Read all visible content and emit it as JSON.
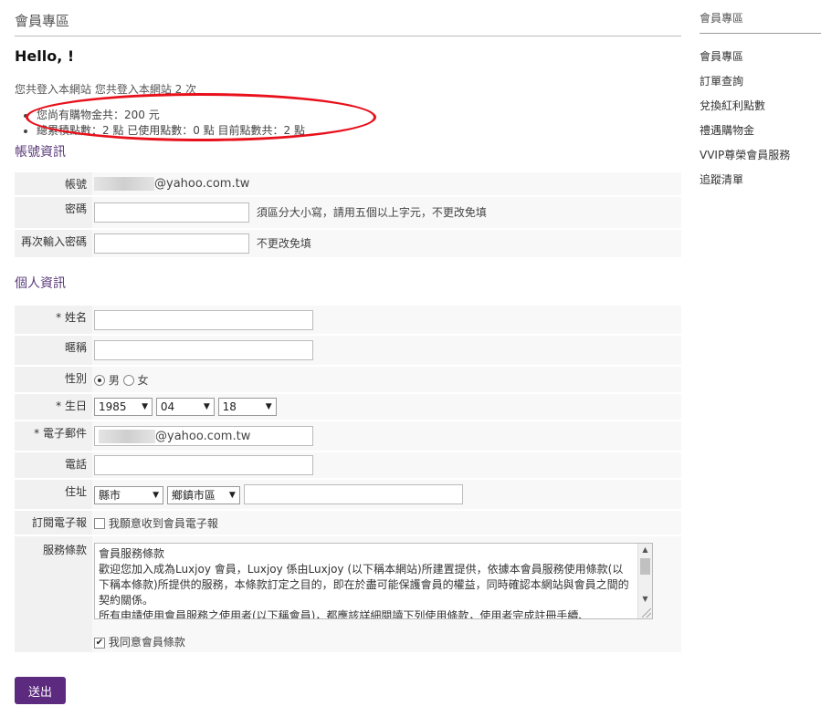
{
  "page_title": "會員專區",
  "hello": "Hello, !",
  "login_line": "您共登入本網站 您共登入本網站 2 次",
  "summary": [
    "您尚有購物金共：200 元",
    "總累積點數：2 點 已使用點數：0 點 目前點數共：2 點"
  ],
  "account_section": {
    "title": "帳號資訊",
    "account_label": "帳號",
    "account_value": "@yahoo.com.tw",
    "password_label": "密碼",
    "password_hint": "須區分大小寫，請用五個以上字元，不更改免填",
    "confirm_label": "再次輸入密碼",
    "confirm_hint": "不更改免填"
  },
  "personal_section": {
    "title": "個人資訊",
    "name_label": "* 姓名",
    "nickname_label": "暱稱",
    "gender_label": "性別",
    "gender_male": "男",
    "gender_female": "女",
    "birthday_label": "* 生日",
    "birth_year": "1985",
    "birth_month": "04",
    "birth_day": "18",
    "email_label": "* 電子郵件",
    "email_value": "@yahoo.com.tw",
    "phone_label": "電話",
    "address_label": "住址",
    "county_placeholder": "縣市",
    "district_placeholder": "鄉鎮市區",
    "newsletter_label": "訂閱電子報",
    "newsletter_option": "我願意收到會員電子報",
    "terms_label": "服務條款",
    "terms_text": "會員服務條款\n歡迎您加入成為Luxjoy 會員，Luxjoy 係由Luxjoy (以下稱本網站)所建置提供，依據本會員服務使用條款(以下稱本條款)所提供的服務，本條款訂定之目的，即在於盡可能保護會員的權益，同時確認本網站與會員之間的契約關係。\n所有申請使用會員服務之使用者(以下稱會員)，都應該詳細閱讀下列使用條款，使用者完成註冊手續、",
    "agree_label": "我同意會員條款"
  },
  "submit_label": "送出",
  "sidebar": {
    "title": "會員專區",
    "items": [
      "會員專區",
      "訂單查詢",
      "兌換紅利點數",
      "禮遇購物金",
      "VVIP尊榮會員服務",
      "追蹤清單"
    ]
  },
  "colors": {
    "accent": "#5c2a7e",
    "highlight": "#e8111b"
  }
}
